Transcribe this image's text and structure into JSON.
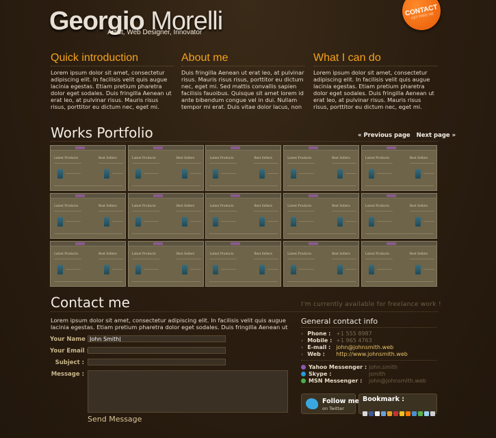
{
  "header": {
    "name_first": "Georgio",
    "name_last": "Morelli",
    "tagline": "Artist, Web Designer, Innovator",
    "badge": "CONTACT",
    "badge_small": "GET FREE ME"
  },
  "intro": [
    {
      "title": "Quick introduction",
      "text": "Lorem ipsum dolor sit amet, consectetur adipiscing elit. In facilisis velit quis augue lacinia egestas. Etiam pretium pharetra dolor eget sodales. Duis fringilla Aenean ut erat leo, at pulvinar risus. Mauris risus risus, porttitor eu dictum nec, eget mi."
    },
    {
      "title": "About me",
      "text": "Duis fringilla Aenean ut erat leo, at pulvinar risus. Mauris risus risus, porttitor eu dictum nec, eget mi. Sed mattis convallis sapien facilisis fauoibus. Quisque sit amet lorem id ante bibendum congue vel in dui. Nullam tempor mi erat. Duis vitae dolor lacus, non"
    },
    {
      "title": "What I can do",
      "text": "Lorem ipsum dolor sit amet, consectetur adipiscing elit. In facilisis velit quis augue lacinia egestas. Etiam pretium pharetra dolor eget sodales. Duis fringilla Aenean ut erat leo, at pulvinar risus. Mauris risus risus, porttitor eu dictum nec, eget mi."
    }
  ],
  "portfolio": {
    "title": "Works Portfolio",
    "prev": "« Previous page",
    "next": "Next page »",
    "thumb_heading_left": "Latest Products",
    "thumb_heading_right": "Best Sellers"
  },
  "contact": {
    "title": "Contact me",
    "freelance": "I'm currently available for freelance work !",
    "intro": "Lorem ipsum dolor sit amet, consectetur adipiscing elit. In facilisis velit quis augue lacinia egestas. Etiam pretium pharetra dolor eget sodales. Duis fringilla Aenean ut",
    "name_label": "Your Name :",
    "name_value": "John Smith|",
    "email_label": "Your Email :",
    "subject_label": "Subject :",
    "message_label": "Message :",
    "send": "Send Message"
  },
  "info": {
    "title": "General contact info",
    "phone_label": "Phone :",
    "phone": "+1 555 8987",
    "mobile_label": "Mobile :",
    "mobile": "+1 965 4763",
    "email_label": "E-mail :",
    "email": "john@johnsmith.web",
    "web_label": "Web :",
    "web": "http://www.johnsmith.web",
    "yahoo_label": "Yahoo Messenger :",
    "yahoo": "john.smith",
    "skype_label": "Skype :",
    "skype": "jsmith",
    "msn_label": "MSN Messenger :",
    "msn": "john@johnsmith.web",
    "follow": "Follow me",
    "follow_sub": "on Twitter",
    "bookmark": "Bookmark :"
  },
  "colors": {
    "accent": "#f6a21a",
    "badge": "#f07010",
    "background": "#2a1d10"
  }
}
